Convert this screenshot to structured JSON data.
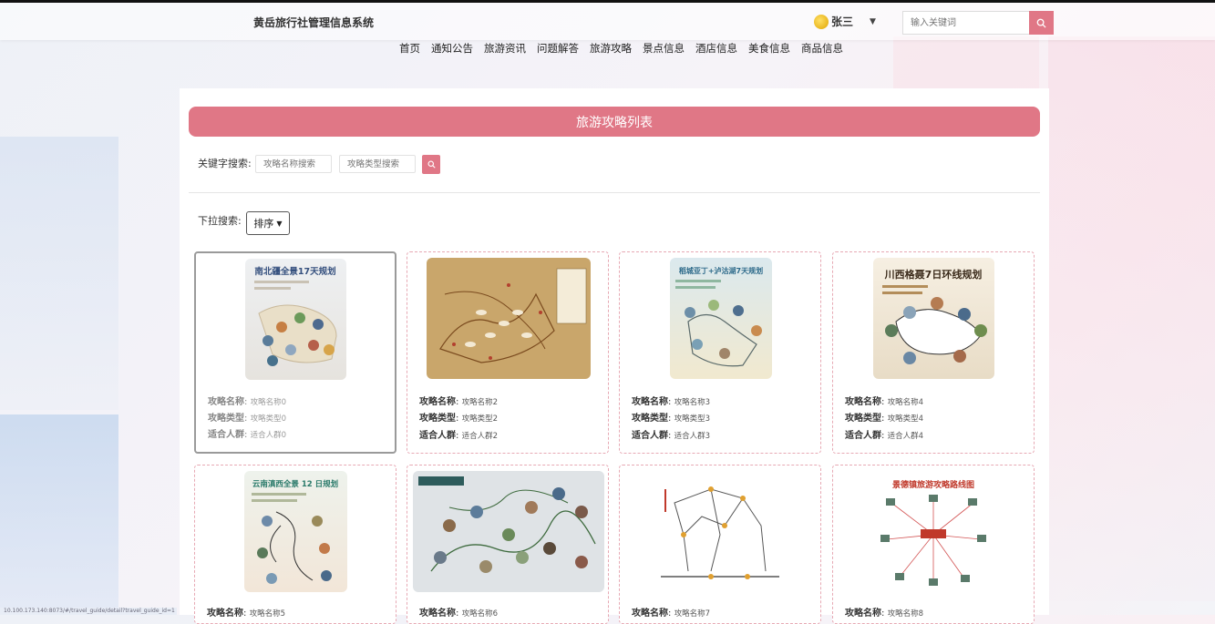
{
  "header": {
    "site_title": "黄岳旅行社管理信息系统",
    "user_name": "张三",
    "search_placeholder": "输入关键词"
  },
  "nav": [
    "首页",
    "通知公告",
    "旅游资讯",
    "问题解答",
    "旅游攻略",
    "景点信息",
    "酒店信息",
    "美食信息",
    "商品信息"
  ],
  "list": {
    "title": "旅游攻略列表",
    "keyword_label": "关键字搜索:",
    "name_placeholder": "攻略名称搜索",
    "type_placeholder": "攻略类型搜索",
    "dropdown_label": "下拉搜索:",
    "sort_label": "排序"
  },
  "field_labels": {
    "name": "攻略名称",
    "type": "攻略类型",
    "crowd": "适合人群"
  },
  "cards": [
    {
      "thumb_title": "南北疆全景17天规划",
      "name": "攻略名称0",
      "type": "攻略类型0",
      "crowd": "适合人群0"
    },
    {
      "thumb_title": "",
      "name": "攻略名称2",
      "type": "攻略类型2",
      "crowd": "适合人群2"
    },
    {
      "thumb_title": "稻城亚丁+泸沽湖7天规划",
      "name": "攻略名称3",
      "type": "攻略类型3",
      "crowd": "适合人群3"
    },
    {
      "thumb_title": "川西格聂7日环线规划",
      "name": "攻略名称4",
      "type": "攻略类型4",
      "crowd": "适合人群4"
    },
    {
      "thumb_title": "云南滇西全景 12 日规划",
      "name": "攻略名称5",
      "type": "",
      "crowd": ""
    },
    {
      "thumb_title": "",
      "name": "攻略名称6",
      "type": "",
      "crowd": ""
    },
    {
      "thumb_title": "",
      "name": "攻略名称7",
      "type": "",
      "crowd": ""
    },
    {
      "thumb_title": "景德镇旅游攻略路线图",
      "name": "攻略名称8",
      "type": "",
      "crowd": ""
    }
  ],
  "status_url": "10.100.173.140:8073/#/travel_guide/detail?travel_guide_id=1",
  "colors": {
    "accent": "#e07786",
    "card_border": "#e7a9b4"
  }
}
